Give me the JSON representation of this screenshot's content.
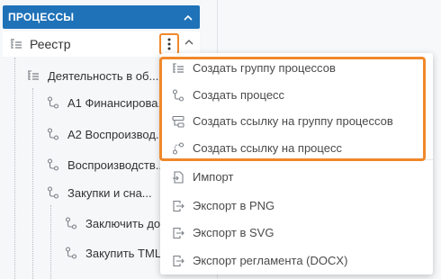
{
  "panel": {
    "title": "ПРОЦЕССЫ",
    "collapse_icon": "chevron-up-icon"
  },
  "registry": {
    "label": "Реестр",
    "icon": "group-list-icon",
    "menu_icon": "more-vertical-icon",
    "expand_icon": "chevron-up-icon"
  },
  "tree": {
    "items": [
      {
        "label": "Деятельность в об...",
        "icon": "group-list-icon"
      },
      {
        "label": "А1 Финансирова...",
        "icon": "process-icon"
      },
      {
        "label": "А2 Воспроизвод...",
        "icon": "process-icon"
      },
      {
        "label": "Воспроизводств...",
        "icon": "process-icon"
      },
      {
        "label": "Закупки и сна...",
        "icon": "process-icon"
      },
      {
        "label": "Заключить до...",
        "icon": "process-icon"
      },
      {
        "label": "Закупить ТМЦ",
        "icon": "process-icon"
      }
    ]
  },
  "context_menu": {
    "create_items": [
      {
        "label": "Создать группу процессов",
        "icon": "group-list-icon"
      },
      {
        "label": "Создать процесс",
        "icon": "process-icon"
      },
      {
        "label": "Создать ссылку на группу процессов",
        "icon": "group-link-icon"
      },
      {
        "label": "Создать ссылку на процесс",
        "icon": "process-link-icon"
      }
    ],
    "other_items": [
      {
        "label": "Импорт",
        "icon": "import-icon"
      },
      {
        "label": "Экспорт в PNG",
        "icon": "export-icon"
      },
      {
        "label": "Экспорт в SVG",
        "icon": "export-icon"
      },
      {
        "label": "Экспорт регламента (DOCX)",
        "icon": "export-icon"
      }
    ]
  },
  "colors": {
    "header_blue": "#1f72b8",
    "highlight_orange": "#f0882b",
    "icon_gray": "#7a7f86"
  }
}
